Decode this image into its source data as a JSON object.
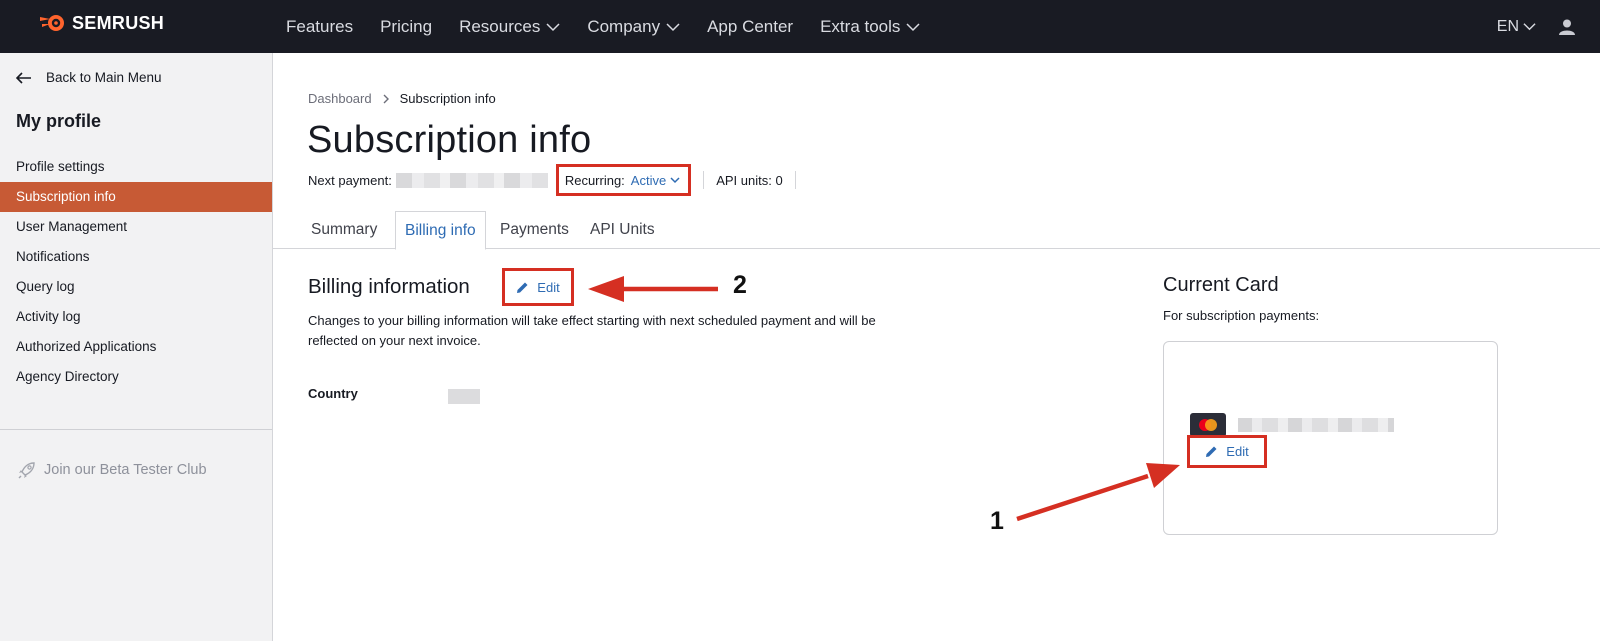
{
  "brand": {
    "name": "SEMRUSH",
    "accent": "#ff642d"
  },
  "topnav": {
    "items": [
      {
        "label": "Features",
        "dropdown": false
      },
      {
        "label": "Pricing",
        "dropdown": false
      },
      {
        "label": "Resources",
        "dropdown": true
      },
      {
        "label": "Company",
        "dropdown": true
      },
      {
        "label": "App Center",
        "dropdown": false
      },
      {
        "label": "Extra tools",
        "dropdown": true
      }
    ],
    "language": "EN",
    "user_icon": "user-icon"
  },
  "sidebar": {
    "back_label": "Back to Main Menu",
    "section_title": "My profile",
    "items": [
      {
        "label": "Profile settings",
        "active": false
      },
      {
        "label": "Subscription info",
        "active": true
      },
      {
        "label": "User Management",
        "active": false
      },
      {
        "label": "Notifications",
        "active": false
      },
      {
        "label": "Query log",
        "active": false
      },
      {
        "label": "Activity log",
        "active": false
      },
      {
        "label": "Authorized Applications",
        "active": false
      },
      {
        "label": "Agency Directory",
        "active": false
      }
    ],
    "beta_label": "Join our Beta Tester Club",
    "active_color": "#c75a35"
  },
  "main": {
    "breadcrumb": {
      "root": "Dashboard",
      "current": "Subscription info"
    },
    "title": "Subscription info",
    "meta": {
      "next_payment_label": "Next payment:",
      "recurring_label": "Recurring:",
      "recurring_value": "Active",
      "api_units_label": "API units: 0"
    },
    "tabs": [
      {
        "label": "Summary",
        "active": false
      },
      {
        "label": "Billing info",
        "active": true
      },
      {
        "label": "Payments",
        "active": false
      },
      {
        "label": "API Units",
        "active": false
      }
    ],
    "billing": {
      "title": "Billing information",
      "edit_label": "Edit",
      "description": "Changes to your billing information will take effect starting with next scheduled payment and will be reflected on your next invoice.",
      "country_label": "Country"
    },
    "card": {
      "title": "Current Card",
      "subtitle": "For subscription payments:",
      "edit_label": "Edit"
    }
  },
  "annotations": {
    "marker_1": "1",
    "marker_2": "2",
    "highlight_color": "#d52f22"
  }
}
